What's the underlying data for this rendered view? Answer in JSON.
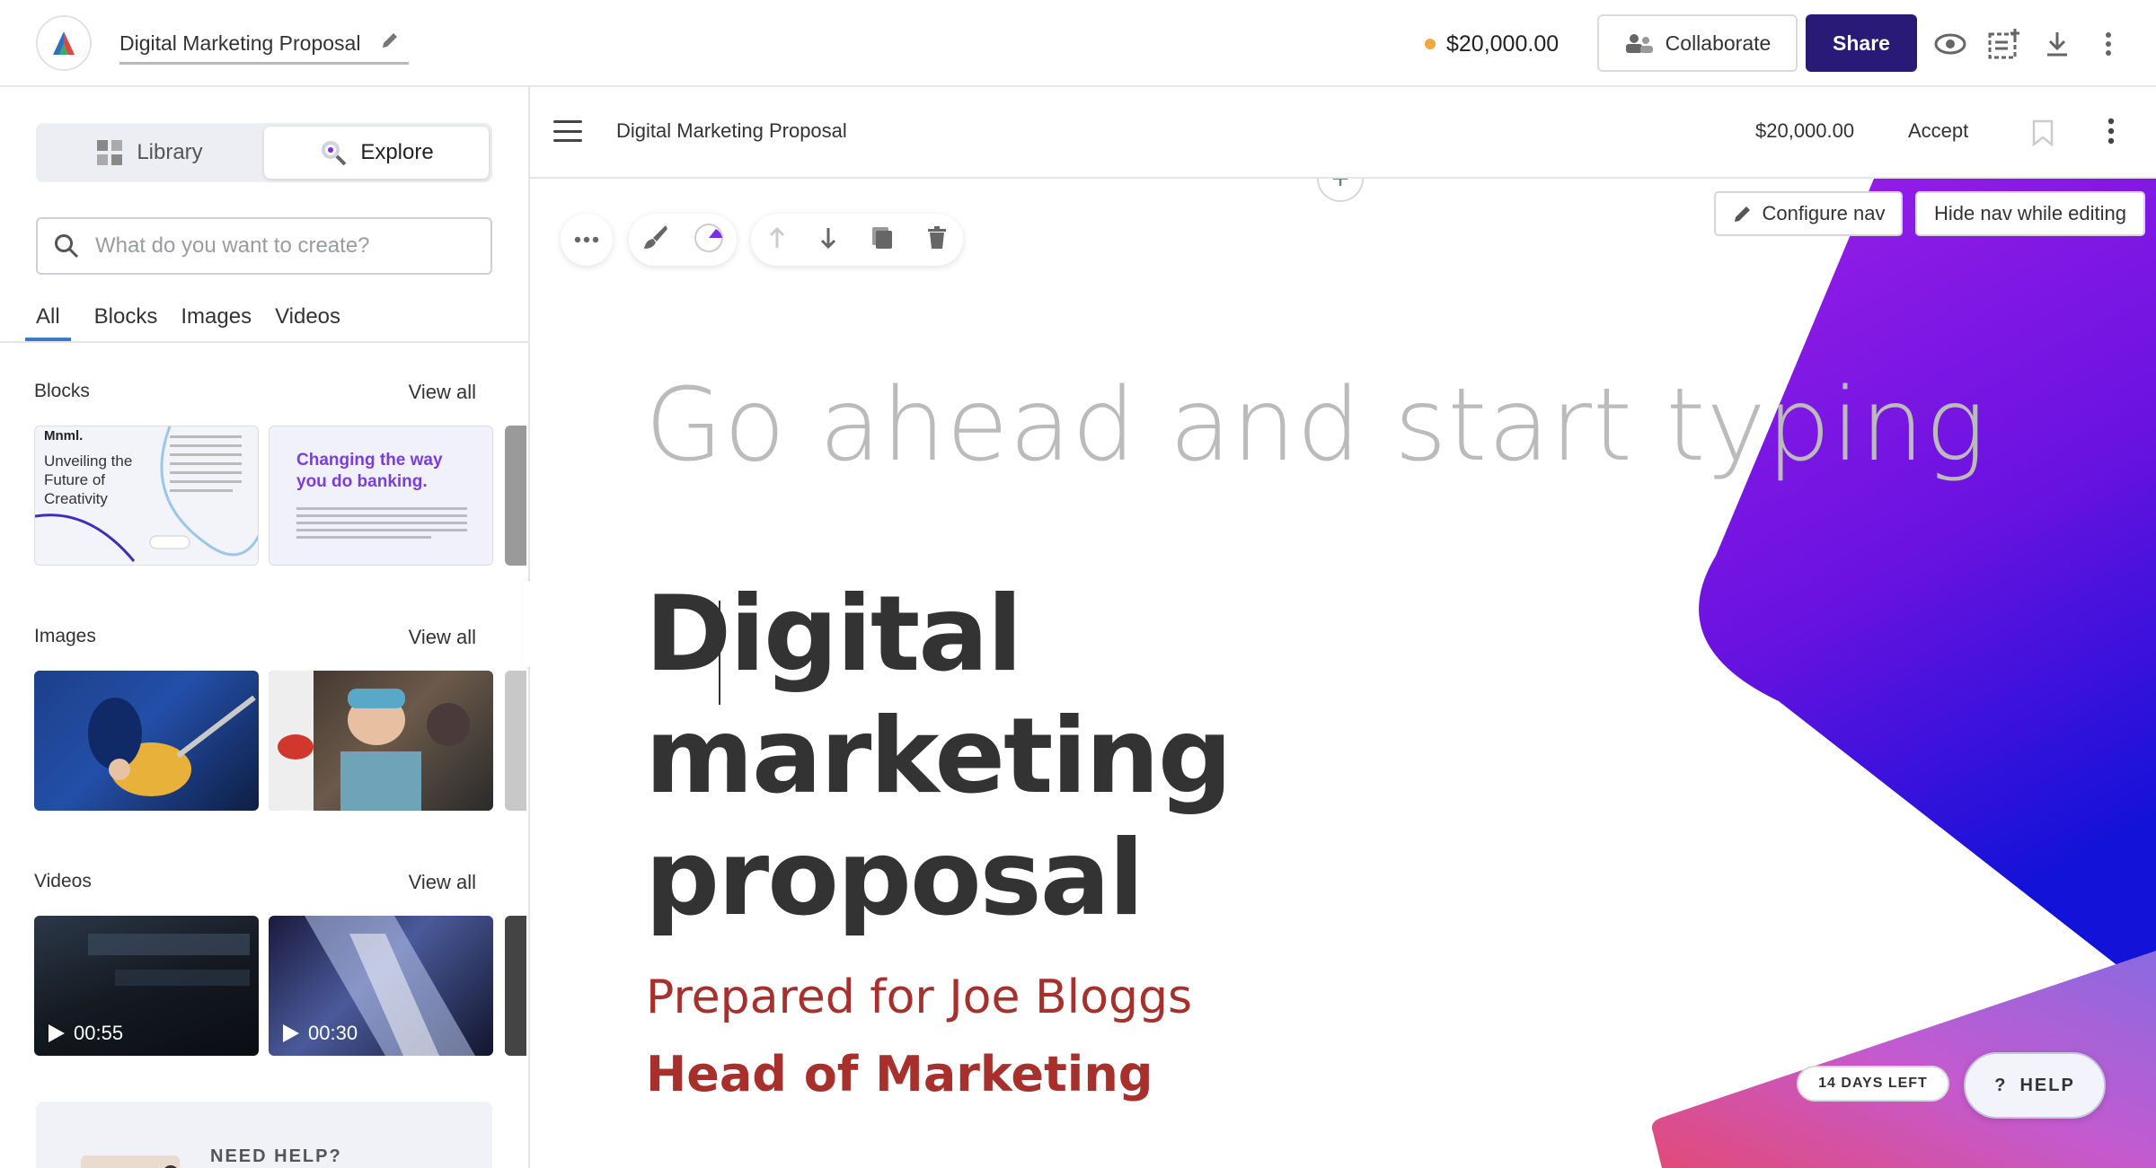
{
  "topbar": {
    "doc_title": "Digital Marketing Proposal",
    "price": "$20,000.00",
    "collaborate_label": "Collaborate",
    "share_label": "Share"
  },
  "sidebar": {
    "library_label": "Library",
    "explore_label": "Explore",
    "search_placeholder": "What do you want to create?",
    "filters": [
      "All",
      "Blocks",
      "Images",
      "Videos"
    ],
    "sections": {
      "blocks": {
        "title": "Blocks",
        "view_all": "View all",
        "items": [
          {
            "brand": "Mnml.",
            "headline": "Unveiling the Future of Creativity"
          },
          {
            "headline": "Changing the way you do banking."
          }
        ]
      },
      "images": {
        "title": "Images",
        "view_all": "View all"
      },
      "videos": {
        "title": "Videos",
        "view_all": "View all",
        "items": [
          {
            "duration": "00:55"
          },
          {
            "duration": "00:30"
          }
        ]
      }
    },
    "help_card_label": "NEED HELP?"
  },
  "editor": {
    "title": "Digital Marketing Proposal",
    "price": "$20,000.00",
    "accept_label": "Accept",
    "configure_nav_label": "Configure nav",
    "hide_nav_label": "Hide nav while editing",
    "placeholder": "Go ahead and start typing",
    "heading_line1": "Digital marketing",
    "heading_line2": "proposal",
    "prepared_for": "Prepared for Joe Bloggs",
    "role": "Head of Marketing",
    "days_left": "14 DAYS LEFT",
    "help_label": "HELP"
  },
  "colors": {
    "share_bg": "#2a1a78",
    "accent_red": "#a8302c",
    "price_dot": "#f0a941",
    "gradient_purple": "#8b1ee8",
    "gradient_pink": "#e0508a"
  }
}
